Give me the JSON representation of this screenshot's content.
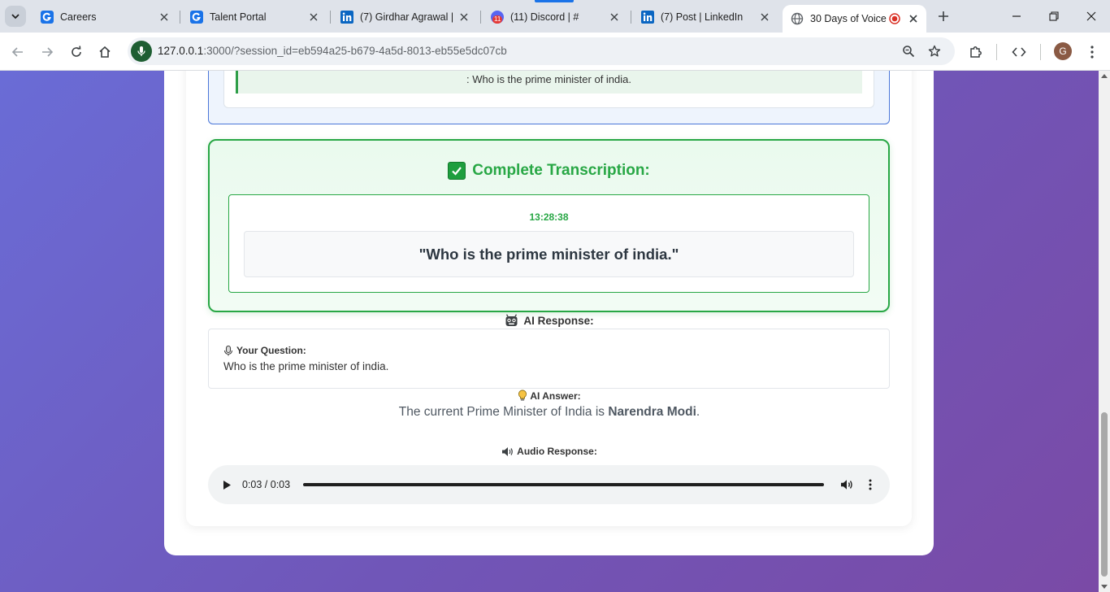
{
  "browser": {
    "tabs": [
      {
        "title": "Careers",
        "favicon": "g-logo-icon"
      },
      {
        "title": "Talent Portal",
        "favicon": "g-logo-icon"
      },
      {
        "title": "(7) Girdhar Agrawal | ",
        "favicon": "linkedin-icon"
      },
      {
        "title": "(11) Discord | #",
        "favicon": "discord-icon",
        "badge": "11"
      },
      {
        "title": "(7) Post | LinkedIn",
        "favicon": "linkedin-icon"
      },
      {
        "title": "30 Days of Voice",
        "favicon": "globe-icon",
        "active": true,
        "recording": true
      }
    ],
    "url_host": "127.0.0.1",
    "url_rest": ":3000/?session_id=eb594a25-b679-4a5d-8013-eb55e5dc07cb",
    "profile_initial": "G"
  },
  "page": {
    "previous_transcription": ": Who is the prime minister of india.",
    "complete_title": "Complete Transcription:",
    "timestamp": "13:28:38",
    "transcript_quote": "\"Who is the prime minister of india.\"",
    "ai_response_heading": "AI Response:",
    "your_question_label": "Your Question:",
    "question_text": "Who is the prime minister of india.",
    "ai_answer_label": "AI Answer:",
    "answer_prefix": "The current Prime Minister of India is ",
    "answer_bold": "Narendra Modi",
    "answer_suffix": ".",
    "audio_response_label": "Audio Response:",
    "audio_time": "0:03 / 0:03"
  },
  "colors": {
    "success": "#28a745",
    "info_border": "#4a76d8",
    "page_gradient_start": "#6a6cd6",
    "page_gradient_end": "#7a4aa6"
  }
}
